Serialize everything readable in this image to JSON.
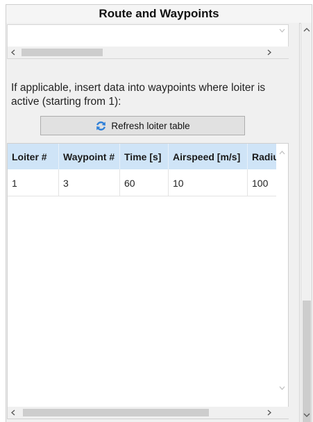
{
  "panel": {
    "title": "Route and Waypoints"
  },
  "instruction": "If applicable, insert data into waypoints where loiter is active (starting from 1):",
  "refresh_button": {
    "label": "Refresh loiter table",
    "icon": "refresh-icon",
    "icon_color": "#2f80d8"
  },
  "loiter_table": {
    "columns": [
      "Loiter #",
      "Waypoint #",
      "Time [s]",
      "Airspeed [m/s]",
      "Radius"
    ],
    "rows": [
      [
        "1",
        "3",
        "60",
        "10",
        "100"
      ]
    ],
    "header_color": "#cfe4f7"
  }
}
